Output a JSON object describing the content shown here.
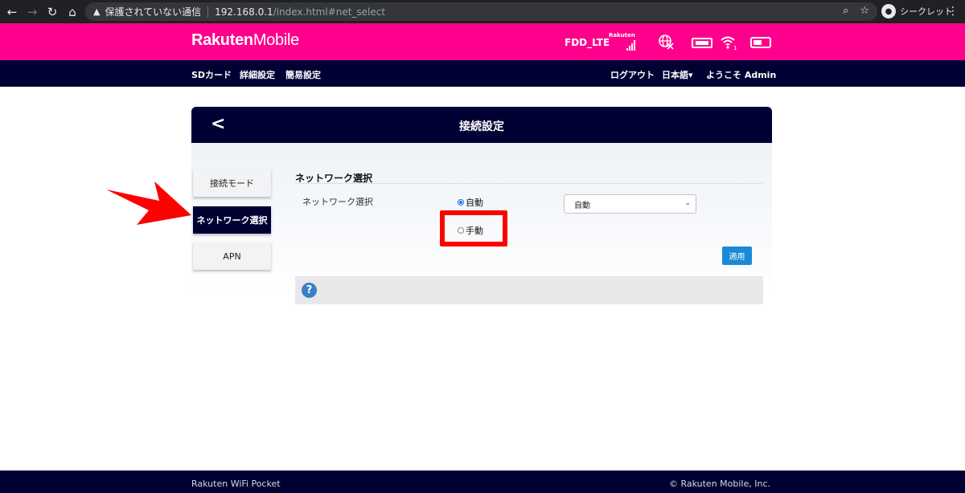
{
  "browser": {
    "security_warning": "保護されていない通信",
    "url_host": "192.168.0.1",
    "url_path": "/index.html#net_select",
    "profile_label": "シークレット"
  },
  "header": {
    "logo_bold": "Rakuten",
    "logo_light": "Mobile",
    "network_type": "FDD_LTE",
    "carrier": "Rakuten",
    "wifi_clients": "1"
  },
  "navbar": {
    "left": [
      "SDカード",
      "詳細設定",
      "簡易設定"
    ],
    "logout": "ログアウト",
    "language": "日本語▾",
    "welcome": "ようこそ Admin"
  },
  "card": {
    "title": "接続設定",
    "sidebar": [
      {
        "label": "接続モード",
        "active": false
      },
      {
        "label": "ネットワーク選択",
        "active": true
      },
      {
        "label": "APN",
        "active": false
      }
    ],
    "section_title": "ネットワーク選択",
    "row_label": "ネットワーク選択",
    "radio_auto": "自動",
    "radio_manual": "手動",
    "select_value": "自動",
    "apply_label": "適用",
    "help_symbol": "?"
  },
  "footer": {
    "product": "Rakuten WiFi Pocket",
    "copyright": "© Rakuten Mobile, Inc."
  },
  "colors": {
    "header_pink": "#ff008c",
    "nav_dark": "#000033",
    "apply_blue": "#1a8ad4",
    "annotation_red": "#ff0000"
  }
}
